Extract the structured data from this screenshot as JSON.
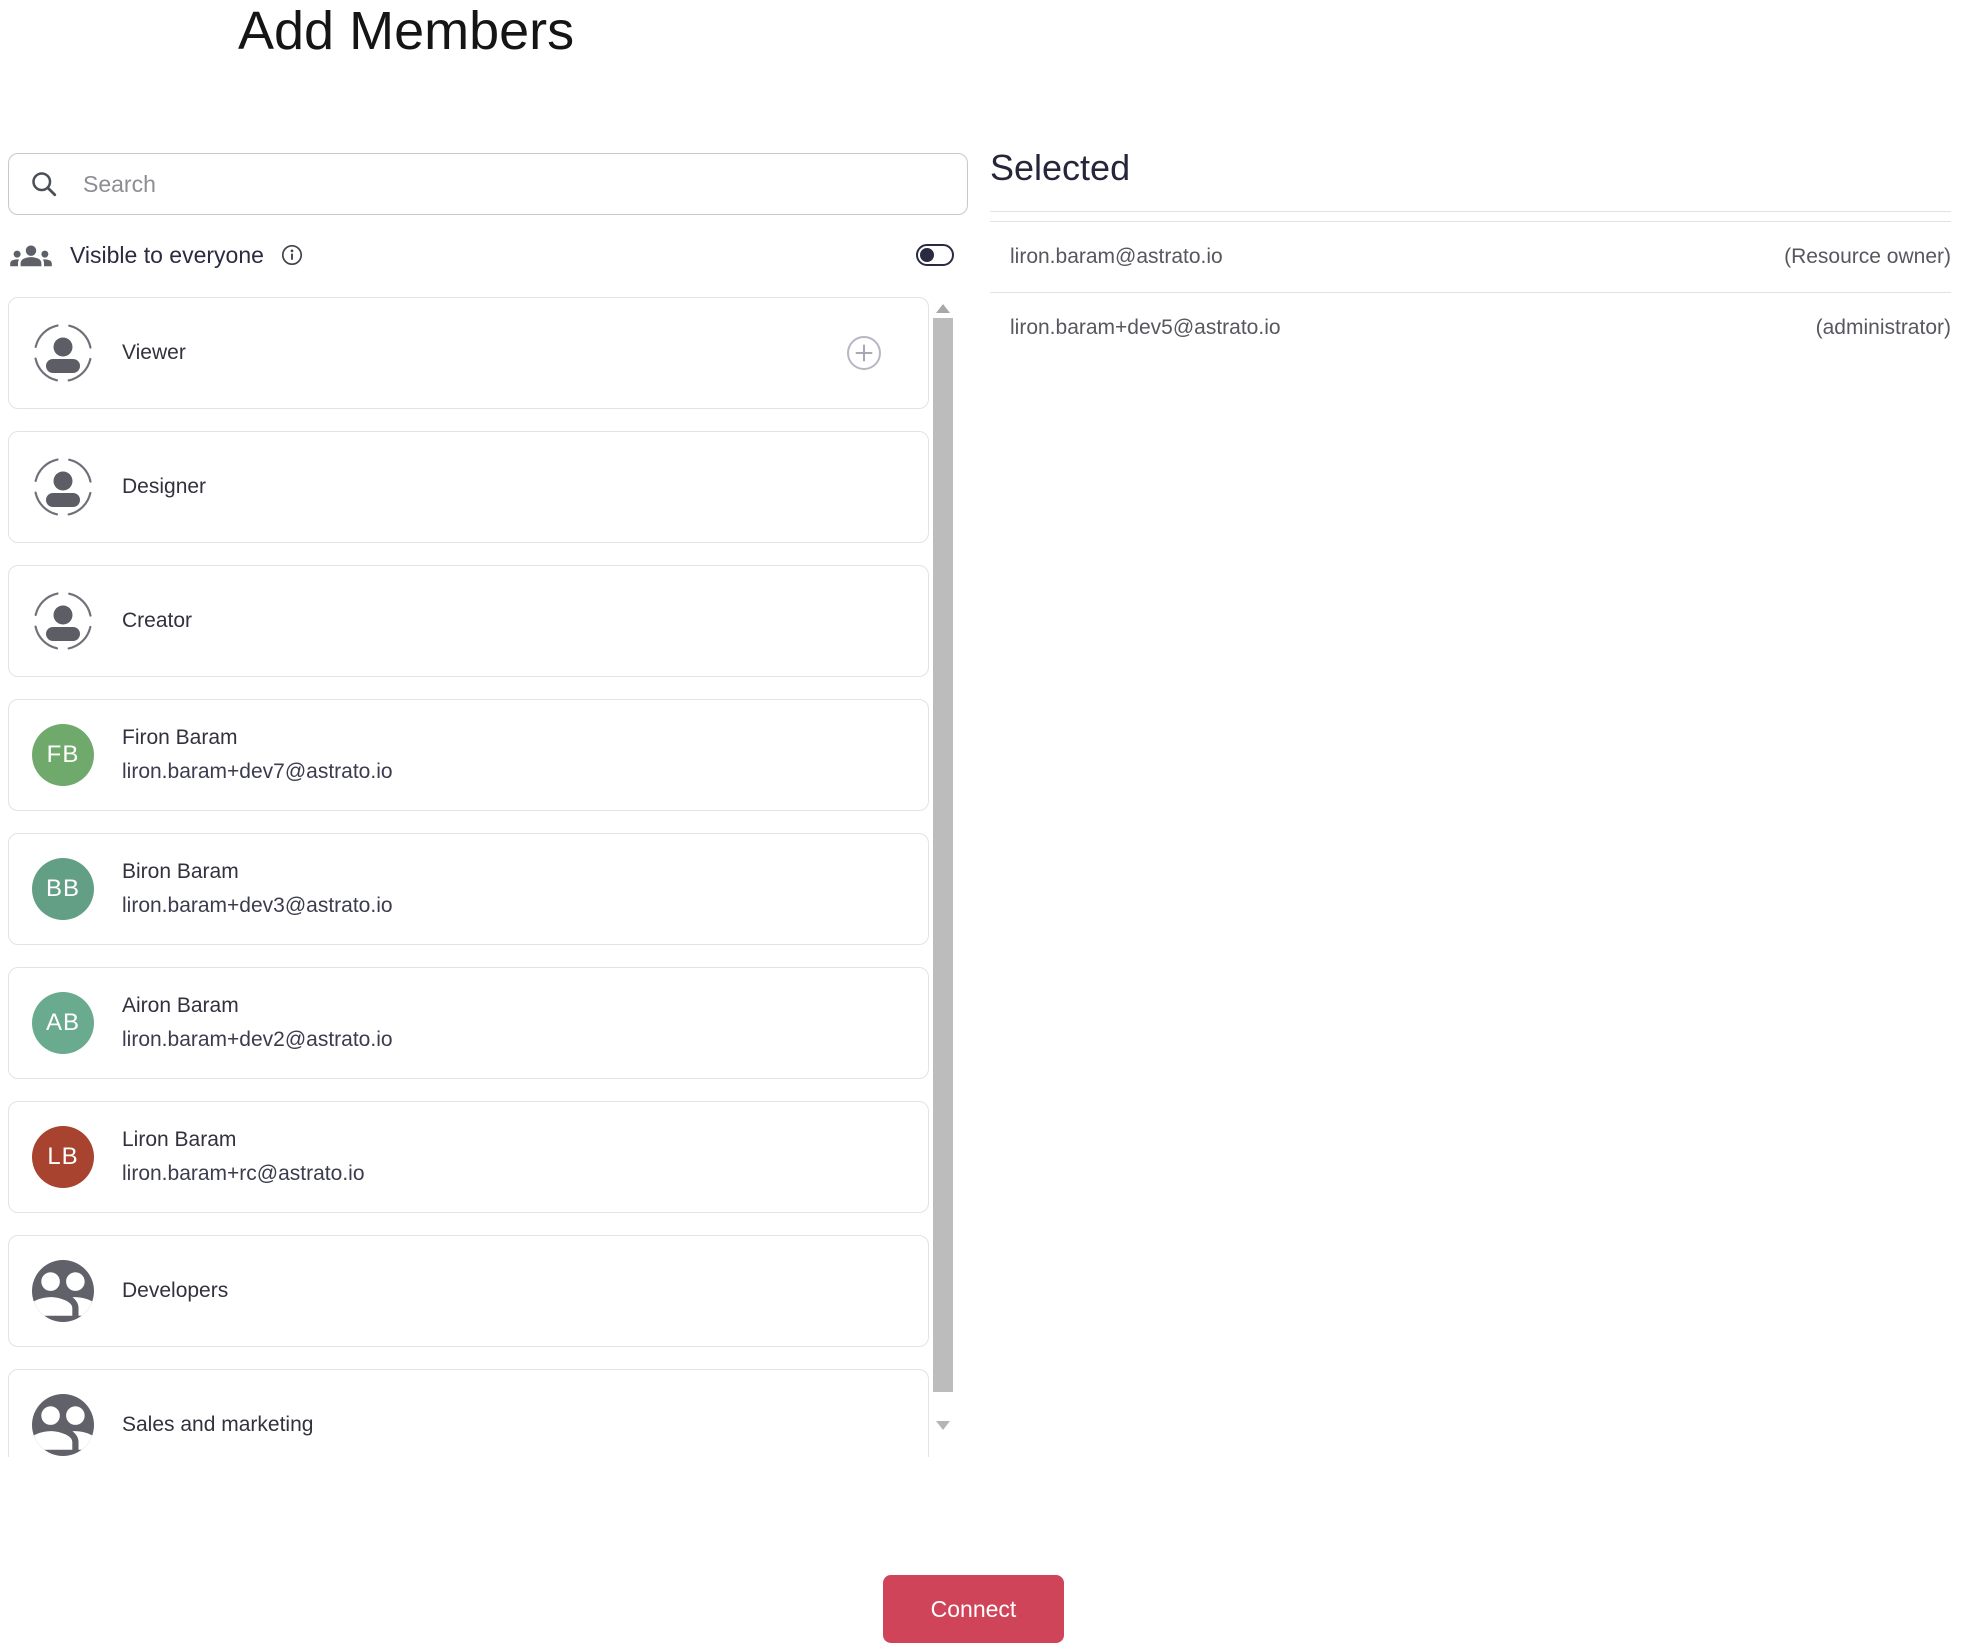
{
  "page": {
    "title": "Add Members",
    "background": "#ffffff"
  },
  "search": {
    "placeholder": "Search",
    "value": ""
  },
  "visibility": {
    "label": "Visible to everyone",
    "leading_icon": "groups-icon",
    "trailing_icon": "info-icon",
    "toggle_state": "off"
  },
  "member_list": {
    "items": [
      {
        "type": "role",
        "label": "Viewer",
        "icon": "person-dashed-icon",
        "has_add_button": true,
        "add_icon": "plus-circle-icon"
      },
      {
        "type": "role",
        "label": "Designer",
        "icon": "person-dashed-icon"
      },
      {
        "type": "role",
        "label": "Creator",
        "icon": "person-dashed-icon"
      },
      {
        "type": "user",
        "name": "Firon Baram",
        "email": "liron.baram+dev7@astrato.io",
        "initials": "FB",
        "avatar_color": "#6fa96b"
      },
      {
        "type": "user",
        "name": "Biron Baram",
        "email": "liron.baram+dev3@astrato.io",
        "initials": "BB",
        "avatar_color": "#639f85"
      },
      {
        "type": "user",
        "name": "Airon Baram",
        "email": "liron.baram+dev2@astrato.io",
        "initials": "AB",
        "avatar_color": "#6aaa8e"
      },
      {
        "type": "user",
        "name": "Liron Baram",
        "email": "liron.baram+rc@astrato.io",
        "initials": "LB",
        "avatar_color": "#a8432f"
      },
      {
        "type": "group",
        "label": "Developers",
        "icon": "group-filled-icon"
      },
      {
        "type": "group",
        "label": "Sales and marketing",
        "icon": "group-filled-icon"
      }
    ],
    "scrollbar": {
      "visible": true,
      "orientation": "vertical"
    }
  },
  "selected_panel": {
    "heading": "Selected",
    "rows": [
      {
        "email": "liron.baram@astrato.io",
        "role": "(Resource owner)"
      },
      {
        "email": "liron.baram+dev5@astrato.io",
        "role": "(administrator)"
      }
    ]
  },
  "footer": {
    "connect_label": "Connect"
  },
  "colors": {
    "accent": "#d04459",
    "card_border": "#e3e3e3",
    "divider": "#e2e2e2",
    "toggle": "#2b2b40",
    "scrollbar_thumb": "#bcbcbc",
    "group_icon_bg": "#606169",
    "text_primary": "#32323f",
    "text_secondary": "#57575f"
  }
}
